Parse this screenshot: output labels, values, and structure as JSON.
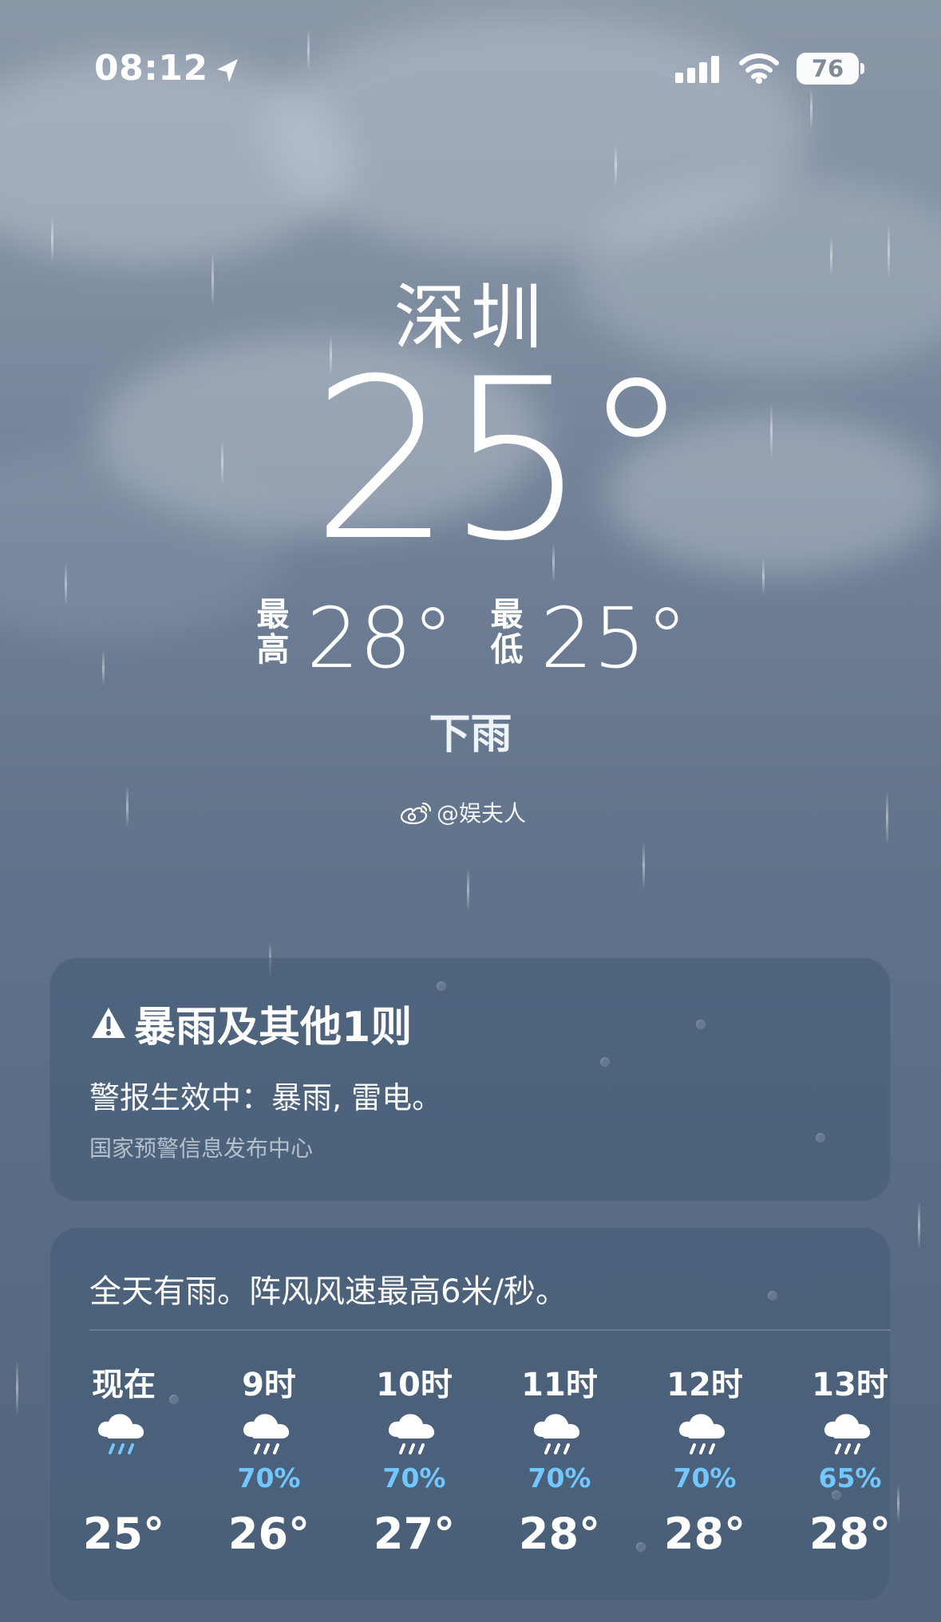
{
  "status_bar": {
    "time": "08:12",
    "battery": "76",
    "location_icon": "location-arrow-icon",
    "signal_icon": "cellular-signal-icon",
    "wifi_icon": "wifi-icon"
  },
  "hero": {
    "city": "深圳",
    "temperature": "25°",
    "high_label": "最高",
    "high_value": "28°",
    "low_label": "最低",
    "low_value": "25°",
    "condition": "下雨"
  },
  "watermark": {
    "icon": "weibo-icon",
    "text": "@娱夫人"
  },
  "alert_card": {
    "title": "暴雨及其他1则",
    "body": "警报生效中：暴雨, 雷电。",
    "source": "国家预警信息发布中心",
    "icon": "warning-icon"
  },
  "hourly_card": {
    "summary": "全天有雨。阵风风速最高6米/秒。",
    "hours": [
      {
        "label": "现在",
        "probability": "",
        "temperature": "25°",
        "icon": "rain-cloud-icon"
      },
      {
        "label": "9时",
        "probability": "70%",
        "temperature": "26°",
        "icon": "rain-cloud-icon"
      },
      {
        "label": "10时",
        "probability": "70%",
        "temperature": "27°",
        "icon": "rain-cloud-icon"
      },
      {
        "label": "11时",
        "probability": "70%",
        "temperature": "28°",
        "icon": "rain-cloud-icon"
      },
      {
        "label": "12时",
        "probability": "70%",
        "temperature": "28°",
        "icon": "rain-cloud-icon"
      },
      {
        "label": "13时",
        "probability": "65%",
        "temperature": "28°",
        "icon": "rain-cloud-icon"
      }
    ]
  },
  "colors": {
    "precipitation": "#73c7ff",
    "card_background": "#465c76"
  }
}
